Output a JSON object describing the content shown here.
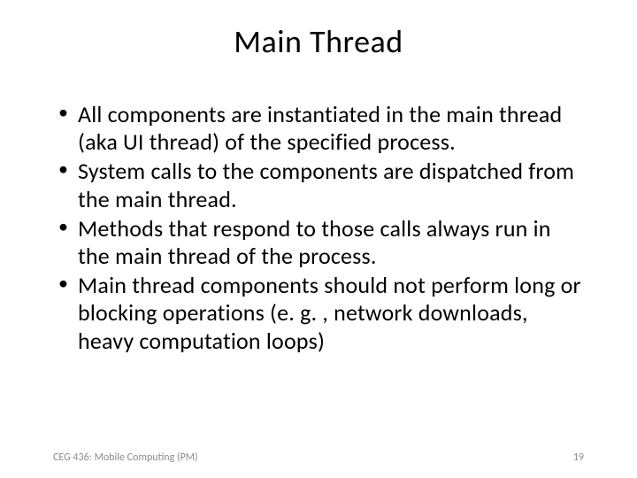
{
  "title": "Main Thread",
  "bullets": [
    "All components are instantiated in the main thread (aka UI thread) of the specified process.",
    "System calls to the components are dispatched from the main thread.",
    "Methods that respond to those calls always run in the main thread of the process.",
    "Main thread components should not perform long or blocking operations (e. g. , network downloads, heavy computation loops)"
  ],
  "footer": {
    "left": "CEG 436: Mobile Computing (PM)",
    "right": "19"
  }
}
